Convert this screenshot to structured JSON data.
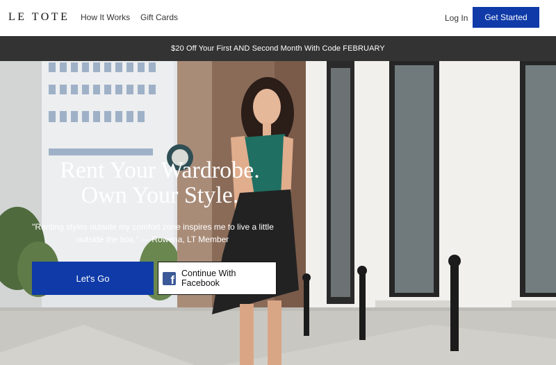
{
  "header": {
    "logo": "LE TOTE",
    "nav": {
      "how_it_works": "How It Works",
      "gift_cards": "Gift Cards"
    },
    "login": "Log In",
    "get_started": "Get Started"
  },
  "promo": {
    "text": "$20 Off Your First AND Second Month With Code FEBRUARY"
  },
  "hero": {
    "title_line1": "Rent Your Wardrobe.",
    "title_line2": "Own Your Style.",
    "quote": "\"Renting styles outside my comfort zone inspires me to live a little outside the box.\" — Rowena, LT Member",
    "cta_primary": "Let's Go",
    "cta_facebook": "Continue With Facebook"
  },
  "colors": {
    "brand_blue": "#0f3aa8",
    "promo_bg": "#333333",
    "facebook_blue": "#3b5998"
  },
  "icons": {
    "facebook": "facebook-icon"
  }
}
